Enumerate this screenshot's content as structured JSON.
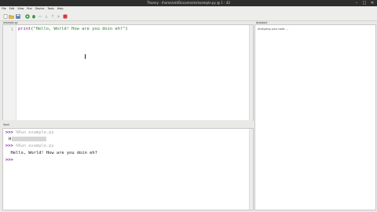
{
  "window": {
    "title": "Thonny  -  /home/ukl/Documents/example.py  @  1 : 42"
  },
  "menu": [
    "File",
    "Edit",
    "View",
    "Run",
    "Device",
    "Tools",
    "Help"
  ],
  "editor": {
    "tab_label": "example.py",
    "line_number": "1",
    "code_fn": "print",
    "code_open": "(",
    "code_string": "\"Hello, World! How are you doin eh?\"",
    "code_close": ")"
  },
  "assistant": {
    "label": "Assistant",
    "message": "Analyzing your code ..."
  },
  "shell": {
    "label": "Shell",
    "lines": [
      {
        "prompt": ">>>",
        "command": " %Run example.py"
      },
      {
        "output_prefix": "H"
      },
      {
        "prompt": ">>>",
        "command": " %Run example.py"
      },
      {
        "output": "  Hello, World! How are you doin eh?"
      },
      {
        "prompt": ">>>"
      }
    ]
  },
  "colors": {
    "prompt": "#7a1d8f",
    "string": "#2a7f2a",
    "muted": "#aaaaaa"
  }
}
